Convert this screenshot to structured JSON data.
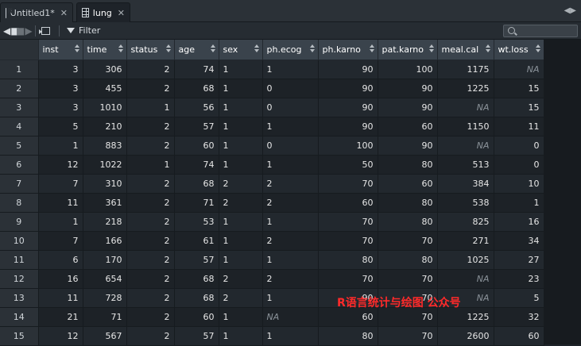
{
  "tabs": [
    {
      "label": "Untitled1*",
      "icon": "r-script-icon",
      "active": false
    },
    {
      "label": "lung",
      "icon": "data-grid-icon",
      "active": true
    }
  ],
  "toolbar": {
    "filter_label": "Filter",
    "search_placeholder": ""
  },
  "columns": [
    "inst",
    "time",
    "status",
    "age",
    "sex",
    "ph.ecog",
    "ph.karno",
    "pat.karno",
    "meal.cal",
    "wt.loss"
  ],
  "rows": [
    [
      "1",
      "3",
      "306",
      "2",
      "74",
      "1",
      "1",
      "90",
      "100",
      "1175",
      "NA"
    ],
    [
      "2",
      "3",
      "455",
      "2",
      "68",
      "1",
      "0",
      "90",
      "90",
      "1225",
      "15"
    ],
    [
      "3",
      "3",
      "1010",
      "1",
      "56",
      "1",
      "0",
      "90",
      "90",
      "NA",
      "15"
    ],
    [
      "4",
      "5",
      "210",
      "2",
      "57",
      "1",
      "1",
      "90",
      "60",
      "1150",
      "11"
    ],
    [
      "5",
      "1",
      "883",
      "2",
      "60",
      "1",
      "0",
      "100",
      "90",
      "NA",
      "0"
    ],
    [
      "6",
      "12",
      "1022",
      "1",
      "74",
      "1",
      "1",
      "50",
      "80",
      "513",
      "0"
    ],
    [
      "7",
      "7",
      "310",
      "2",
      "68",
      "2",
      "2",
      "70",
      "60",
      "384",
      "10"
    ],
    [
      "8",
      "11",
      "361",
      "2",
      "71",
      "2",
      "2",
      "60",
      "80",
      "538",
      "1"
    ],
    [
      "9",
      "1",
      "218",
      "2",
      "53",
      "1",
      "1",
      "70",
      "80",
      "825",
      "16"
    ],
    [
      "10",
      "7",
      "166",
      "2",
      "61",
      "1",
      "2",
      "70",
      "70",
      "271",
      "34"
    ],
    [
      "11",
      "6",
      "170",
      "2",
      "57",
      "1",
      "1",
      "80",
      "80",
      "1025",
      "27"
    ],
    [
      "12",
      "16",
      "654",
      "2",
      "68",
      "2",
      "2",
      "70",
      "70",
      "NA",
      "23"
    ],
    [
      "13",
      "11",
      "728",
      "2",
      "68",
      "2",
      "1",
      "90",
      "70",
      "NA",
      "5"
    ],
    [
      "14",
      "21",
      "71",
      "2",
      "60",
      "1",
      "NA",
      "60",
      "70",
      "1225",
      "32"
    ],
    [
      "15",
      "12",
      "567",
      "2",
      "57",
      "1",
      "1",
      "80",
      "70",
      "2600",
      "60"
    ]
  ],
  "watermark": "R语言统计与绘图 公众号",
  "colors": {
    "watermark": "#ff2a2a",
    "header_bg": "#3a434c",
    "na_text": "#8b939a"
  }
}
